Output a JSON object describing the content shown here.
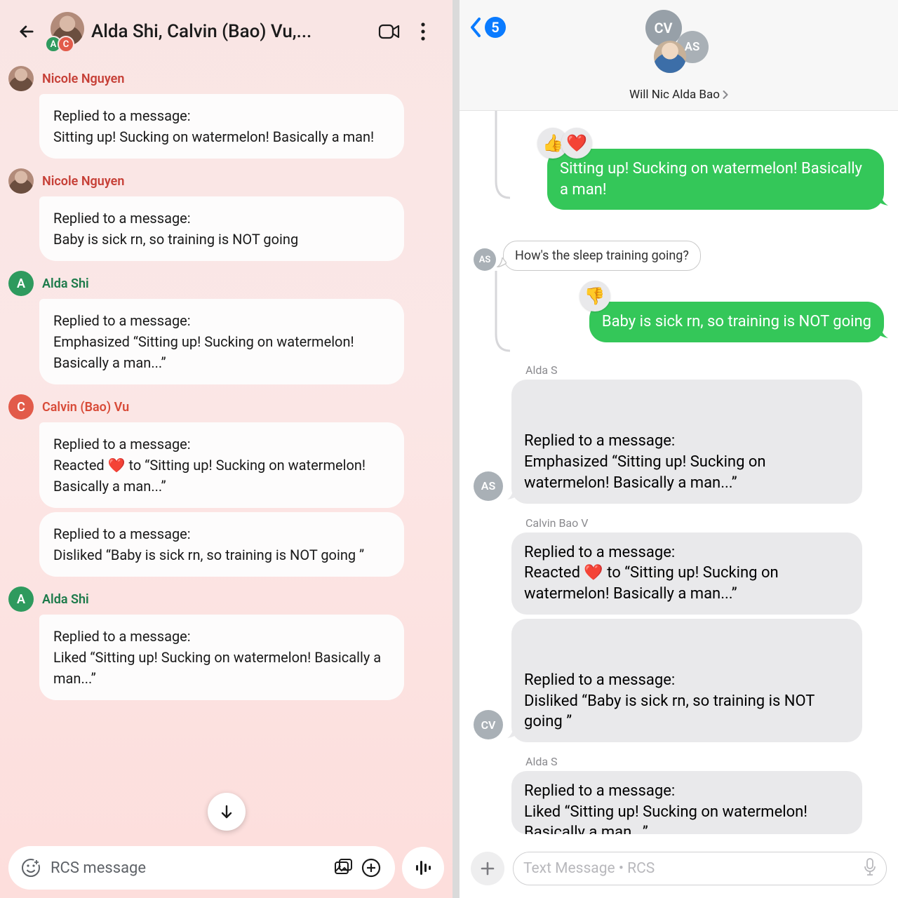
{
  "android": {
    "header": {
      "title": "Alda Shi, Calvin (Bao) Vu,...",
      "cluster_letters": [
        "A",
        "C"
      ]
    },
    "senders": {
      "nicole": "Nicole Nguyen",
      "alda": "Alda Shi",
      "calvin": "Calvin (Bao) Vu"
    },
    "avatar_letters": {
      "alda": "A",
      "calvin": "C"
    },
    "messages": {
      "m1": "Replied to a message:\nSitting up! Sucking on watermelon! Basically a man!",
      "m2": "Replied to a message:\nBaby is sick rn, so training is NOT going",
      "m3": "Replied to a message:\nEmphasized “Sitting up! Sucking on watermelon! Basically a man...”",
      "m4": "Replied to a message:\nReacted ❤️ to “Sitting up! Sucking on watermelon! Basically a man...”",
      "m5": "Replied to a message:\nDisliked “Baby is sick rn, so training is NOT going ”",
      "m6": "Replied to a message:\nLiked “Sitting up! Sucking on watermelon! Basically a man...”"
    },
    "input_placeholder": "RCS message"
  },
  "imessage": {
    "back_count": "5",
    "cluster": {
      "cv": "CV",
      "as": "AS"
    },
    "group_name": "Will Nic Alda Bao",
    "green1": "Sitting up! Sucking on watermelon! Basically a man!",
    "reactions1": [
      "👍",
      "❤️"
    ],
    "incoming_small": "How's the sleep training going?",
    "incoming_av": "AS",
    "reactions2": [
      "👎"
    ],
    "green2": "Baby is sick rn, so training is NOT going",
    "senders": {
      "alda": "Alda S",
      "calvin": "Calvin Bao V"
    },
    "grey1": "Replied to a message:\nEmphasized “Sitting up! Sucking on watermelon! Basically a man...”",
    "grey2": "Replied to a message:\nReacted ❤️ to “Sitting up! Sucking on watermelon! Basically a man...”",
    "grey3": "Replied to a message:\nDisliked “Baby is sick rn, so training is NOT going ”",
    "grey4": "Replied to a message:\nLiked “Sitting up! Sucking on watermelon! Basically a man...”",
    "av_as": "AS",
    "av_cv": "CV",
    "input_placeholder": "Text Message • RCS"
  }
}
